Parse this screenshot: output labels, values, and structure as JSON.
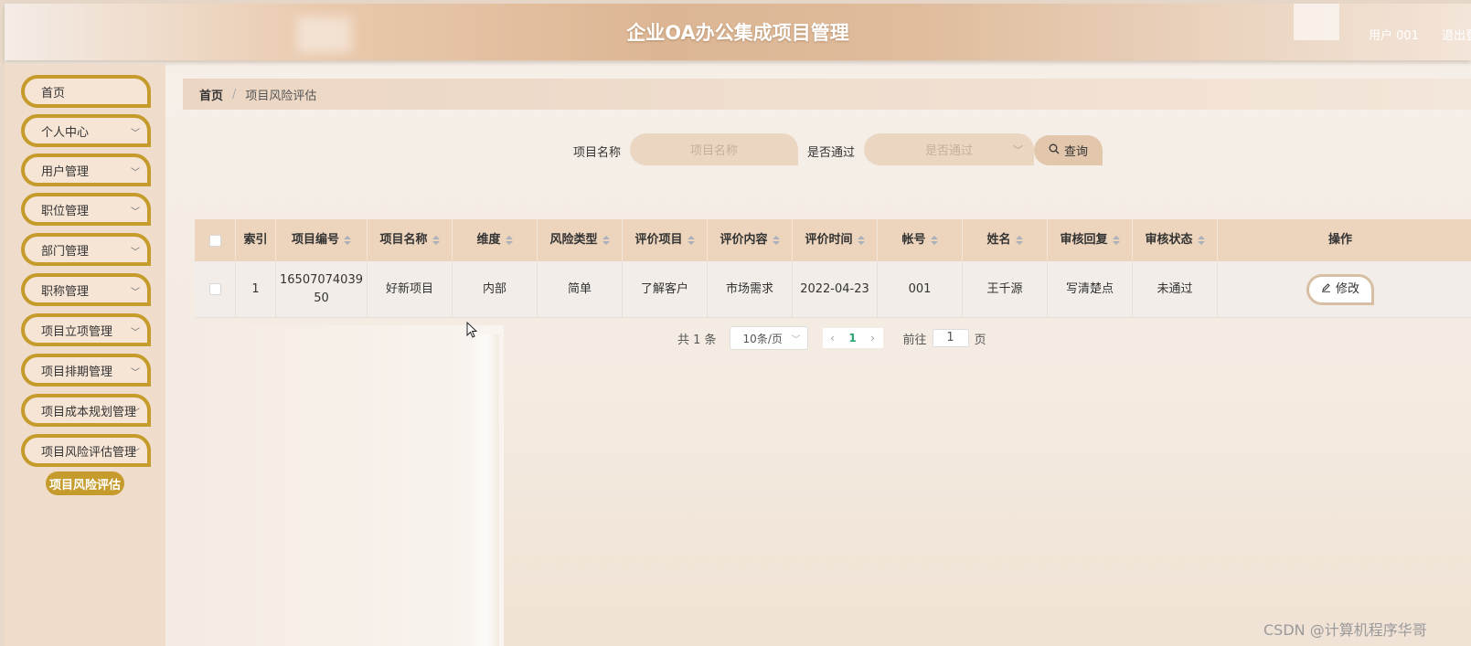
{
  "header": {
    "title": "企业OA办公集成项目管理",
    "user": "用户 001",
    "logout": "退出登"
  },
  "sidebar": {
    "items": [
      {
        "label": "首页",
        "has_arrow": false
      },
      {
        "label": "个人中心",
        "has_arrow": true
      },
      {
        "label": "用户管理",
        "has_arrow": true
      },
      {
        "label": "职位管理",
        "has_arrow": true
      },
      {
        "label": "部门管理",
        "has_arrow": true
      },
      {
        "label": "职称管理",
        "has_arrow": true
      },
      {
        "label": "项目立项管理",
        "has_arrow": true
      },
      {
        "label": "项目排期管理",
        "has_arrow": true
      },
      {
        "label": "项目成本规划管理",
        "has_arrow": true
      },
      {
        "label": "项目风险评估管理",
        "has_arrow": true
      }
    ],
    "active_sub": "项目风险评估"
  },
  "breadcrumb": {
    "home": "首页",
    "separator": "/",
    "current": "项目风险评估"
  },
  "search": {
    "name_label": "项目名称",
    "name_placeholder": "项目名称",
    "pass_label": "是否通过",
    "pass_placeholder": "是否通过",
    "query_button": "查询"
  },
  "table": {
    "headers": [
      "索引",
      "项目编号",
      "项目名称",
      "维度",
      "风险类型",
      "评价项目",
      "评价内容",
      "评价时间",
      "帐号",
      "姓名",
      "审核回复",
      "审核状态",
      "操作"
    ],
    "rows": [
      {
        "index": "1",
        "project_no": "16507074039 50",
        "project_name": "好新项目",
        "dimension": "内部",
        "risk_type": "简单",
        "eval_item": "了解客户",
        "eval_content": "市场需求",
        "eval_time": "2022-04-23",
        "account": "001",
        "name": "王千源",
        "review_reply": "写清楚点",
        "review_status": "未通过",
        "action": "修改"
      }
    ]
  },
  "pagination": {
    "total": "共 1 条",
    "page_size": "10条/页",
    "current_page": "1",
    "goto_label": "前往",
    "goto_value": "1",
    "page_suffix": "页"
  },
  "watermark": "CSDN @计算机程序华哥",
  "colors": {
    "accent_gold": "#c59b2c",
    "header_tan": "#dcb694",
    "table_header": "#ecd4bd"
  }
}
